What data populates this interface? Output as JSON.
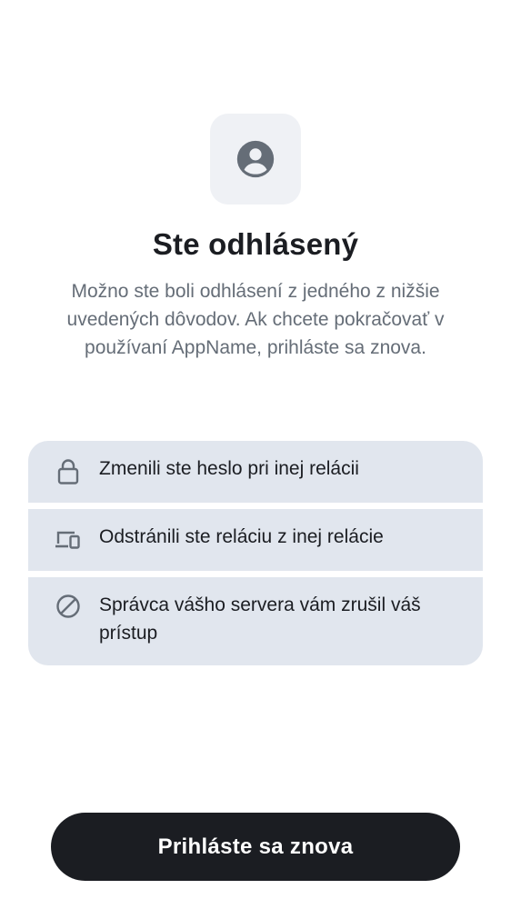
{
  "header": {
    "avatar_icon": "user-avatar-icon",
    "title": "Ste odhlásený",
    "description": "Možno ste boli odhlásení z jedného z nižšie uvedených dôvodov. Ak chcete pokračovať v používaní AppName, prihláste sa znova."
  },
  "reasons": [
    {
      "icon": "lock-icon",
      "label": "Zmenili ste heslo pri inej relácii"
    },
    {
      "icon": "devices-icon",
      "label": "Odstránili ste reláciu z inej relácie"
    },
    {
      "icon": "block-icon",
      "label": "Správca vášho servera vám zrušil váš prístup"
    }
  ],
  "actions": {
    "signin_label": "Prihláste sa znova"
  },
  "colors": {
    "primary": "#1b1d22",
    "card_background": "#e1e6ee",
    "avatar_background": "#eff1f5",
    "icon": "#656d77",
    "secondary_text": "#656d77"
  }
}
